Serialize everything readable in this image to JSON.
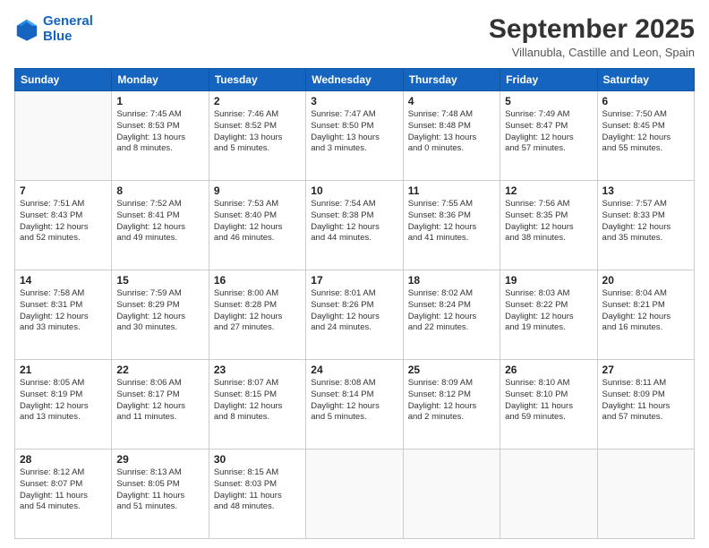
{
  "header": {
    "logo_line1": "General",
    "logo_line2": "Blue",
    "month": "September 2025",
    "location": "Villanubla, Castille and Leon, Spain"
  },
  "weekdays": [
    "Sunday",
    "Monday",
    "Tuesday",
    "Wednesday",
    "Thursday",
    "Friday",
    "Saturday"
  ],
  "weeks": [
    [
      {
        "day": "",
        "info": ""
      },
      {
        "day": "1",
        "info": "Sunrise: 7:45 AM\nSunset: 8:53 PM\nDaylight: 13 hours\nand 8 minutes."
      },
      {
        "day": "2",
        "info": "Sunrise: 7:46 AM\nSunset: 8:52 PM\nDaylight: 13 hours\nand 5 minutes."
      },
      {
        "day": "3",
        "info": "Sunrise: 7:47 AM\nSunset: 8:50 PM\nDaylight: 13 hours\nand 3 minutes."
      },
      {
        "day": "4",
        "info": "Sunrise: 7:48 AM\nSunset: 8:48 PM\nDaylight: 13 hours\nand 0 minutes."
      },
      {
        "day": "5",
        "info": "Sunrise: 7:49 AM\nSunset: 8:47 PM\nDaylight: 12 hours\nand 57 minutes."
      },
      {
        "day": "6",
        "info": "Sunrise: 7:50 AM\nSunset: 8:45 PM\nDaylight: 12 hours\nand 55 minutes."
      }
    ],
    [
      {
        "day": "7",
        "info": "Sunrise: 7:51 AM\nSunset: 8:43 PM\nDaylight: 12 hours\nand 52 minutes."
      },
      {
        "day": "8",
        "info": "Sunrise: 7:52 AM\nSunset: 8:41 PM\nDaylight: 12 hours\nand 49 minutes."
      },
      {
        "day": "9",
        "info": "Sunrise: 7:53 AM\nSunset: 8:40 PM\nDaylight: 12 hours\nand 46 minutes."
      },
      {
        "day": "10",
        "info": "Sunrise: 7:54 AM\nSunset: 8:38 PM\nDaylight: 12 hours\nand 44 minutes."
      },
      {
        "day": "11",
        "info": "Sunrise: 7:55 AM\nSunset: 8:36 PM\nDaylight: 12 hours\nand 41 minutes."
      },
      {
        "day": "12",
        "info": "Sunrise: 7:56 AM\nSunset: 8:35 PM\nDaylight: 12 hours\nand 38 minutes."
      },
      {
        "day": "13",
        "info": "Sunrise: 7:57 AM\nSunset: 8:33 PM\nDaylight: 12 hours\nand 35 minutes."
      }
    ],
    [
      {
        "day": "14",
        "info": "Sunrise: 7:58 AM\nSunset: 8:31 PM\nDaylight: 12 hours\nand 33 minutes."
      },
      {
        "day": "15",
        "info": "Sunrise: 7:59 AM\nSunset: 8:29 PM\nDaylight: 12 hours\nand 30 minutes."
      },
      {
        "day": "16",
        "info": "Sunrise: 8:00 AM\nSunset: 8:28 PM\nDaylight: 12 hours\nand 27 minutes."
      },
      {
        "day": "17",
        "info": "Sunrise: 8:01 AM\nSunset: 8:26 PM\nDaylight: 12 hours\nand 24 minutes."
      },
      {
        "day": "18",
        "info": "Sunrise: 8:02 AM\nSunset: 8:24 PM\nDaylight: 12 hours\nand 22 minutes."
      },
      {
        "day": "19",
        "info": "Sunrise: 8:03 AM\nSunset: 8:22 PM\nDaylight: 12 hours\nand 19 minutes."
      },
      {
        "day": "20",
        "info": "Sunrise: 8:04 AM\nSunset: 8:21 PM\nDaylight: 12 hours\nand 16 minutes."
      }
    ],
    [
      {
        "day": "21",
        "info": "Sunrise: 8:05 AM\nSunset: 8:19 PM\nDaylight: 12 hours\nand 13 minutes."
      },
      {
        "day": "22",
        "info": "Sunrise: 8:06 AM\nSunset: 8:17 PM\nDaylight: 12 hours\nand 11 minutes."
      },
      {
        "day": "23",
        "info": "Sunrise: 8:07 AM\nSunset: 8:15 PM\nDaylight: 12 hours\nand 8 minutes."
      },
      {
        "day": "24",
        "info": "Sunrise: 8:08 AM\nSunset: 8:14 PM\nDaylight: 12 hours\nand 5 minutes."
      },
      {
        "day": "25",
        "info": "Sunrise: 8:09 AM\nSunset: 8:12 PM\nDaylight: 12 hours\nand 2 minutes."
      },
      {
        "day": "26",
        "info": "Sunrise: 8:10 AM\nSunset: 8:10 PM\nDaylight: 11 hours\nand 59 minutes."
      },
      {
        "day": "27",
        "info": "Sunrise: 8:11 AM\nSunset: 8:09 PM\nDaylight: 11 hours\nand 57 minutes."
      }
    ],
    [
      {
        "day": "28",
        "info": "Sunrise: 8:12 AM\nSunset: 8:07 PM\nDaylight: 11 hours\nand 54 minutes."
      },
      {
        "day": "29",
        "info": "Sunrise: 8:13 AM\nSunset: 8:05 PM\nDaylight: 11 hours\nand 51 minutes."
      },
      {
        "day": "30",
        "info": "Sunrise: 8:15 AM\nSunset: 8:03 PM\nDaylight: 11 hours\nand 48 minutes."
      },
      {
        "day": "",
        "info": ""
      },
      {
        "day": "",
        "info": ""
      },
      {
        "day": "",
        "info": ""
      },
      {
        "day": "",
        "info": ""
      }
    ]
  ]
}
